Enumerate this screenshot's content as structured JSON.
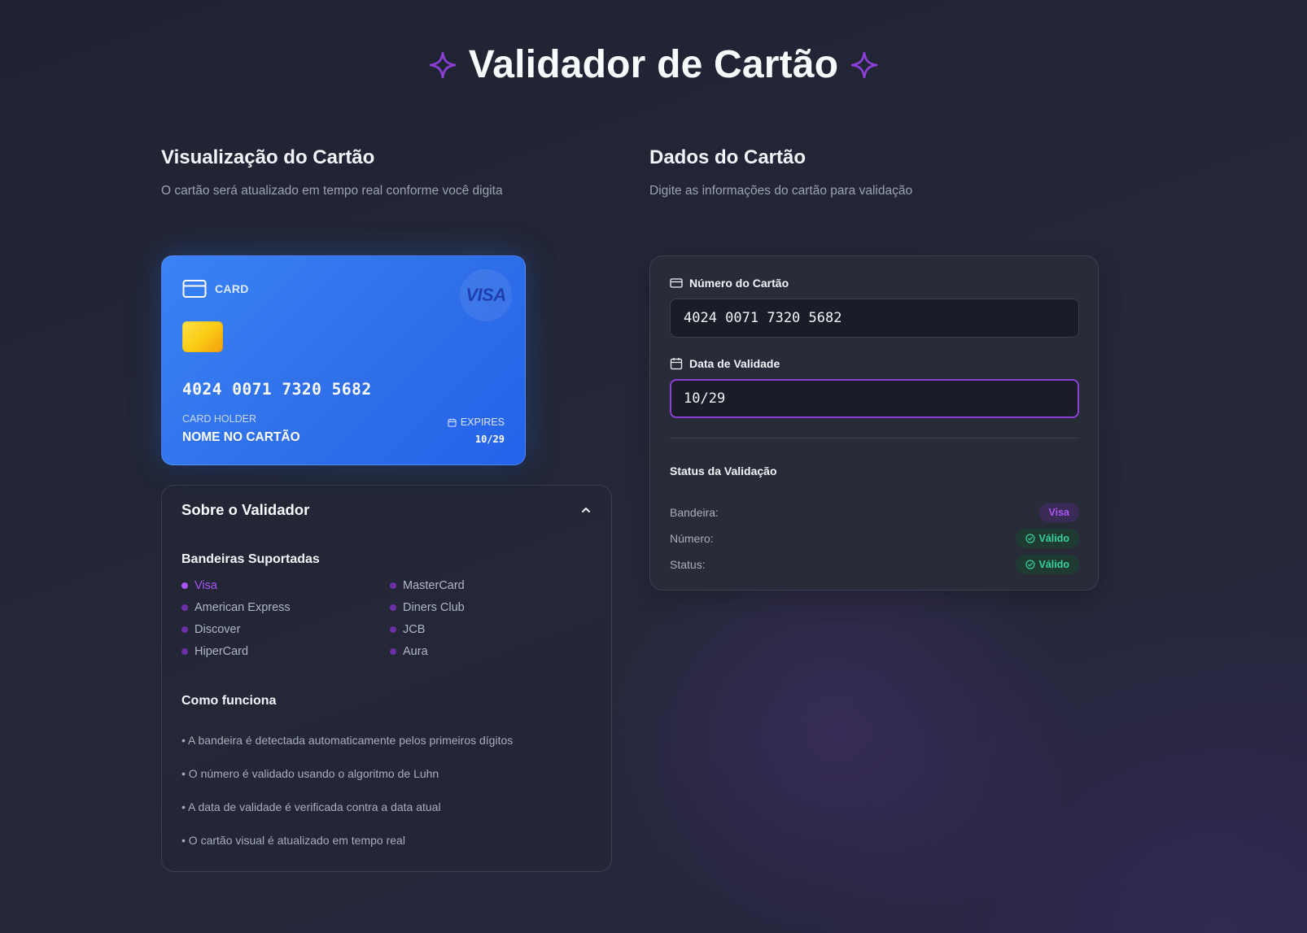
{
  "page": {
    "title": "Validador de Cartão"
  },
  "preview": {
    "title": "Visualização do Cartão",
    "subtitle": "O cartão será atualizado em tempo real conforme você digita"
  },
  "card": {
    "type_label": "CARD",
    "brand_logo": "VISA",
    "number": "4024 0071 7320 5682",
    "holder_label": "CARD HOLDER",
    "holder_name": "NOME NO CARTÃO",
    "expires_label": "EXPIRES",
    "expires_value": "10/29",
    "accent_color": "#3b82f6"
  },
  "about": {
    "title": "Sobre o Validador",
    "brands_title": "Bandeiras Suportadas",
    "brands": [
      {
        "name": "Visa",
        "active": true
      },
      {
        "name": "MasterCard",
        "active": false
      },
      {
        "name": "American Express",
        "active": false
      },
      {
        "name": "Diners Club",
        "active": false
      },
      {
        "name": "Discover",
        "active": false
      },
      {
        "name": "JCB",
        "active": false
      },
      {
        "name": "HiperCard",
        "active": false
      },
      {
        "name": "Aura",
        "active": false
      }
    ],
    "how_title": "Como funciona",
    "how_items": [
      "• A bandeira é detectada automaticamente pelos primeiros dígitos",
      "• O número é validado usando o algoritmo de Luhn",
      "• A data de validade é verificada contra a data atual",
      "• O cartão visual é atualizado em tempo real"
    ]
  },
  "form": {
    "title": "Dados do Cartão",
    "subtitle": "Digite as informações do cartão para validação",
    "number_label": "Número do Cartão",
    "number_value": "4024 0071 7320 5682",
    "expiry_label": "Data de Validade",
    "expiry_value": "10/29",
    "status_title": "Status da Validação",
    "status_rows": [
      {
        "label": "Bandeira:",
        "value": "Visa",
        "tone": "purple"
      },
      {
        "label": "Número:",
        "value": "Válido",
        "tone": "green"
      },
      {
        "label": "Status:",
        "value": "Válido",
        "tone": "green"
      }
    ]
  },
  "colors": {
    "accent_purple": "#a855f7",
    "valid_green": "#34d399",
    "background": "#232634"
  }
}
